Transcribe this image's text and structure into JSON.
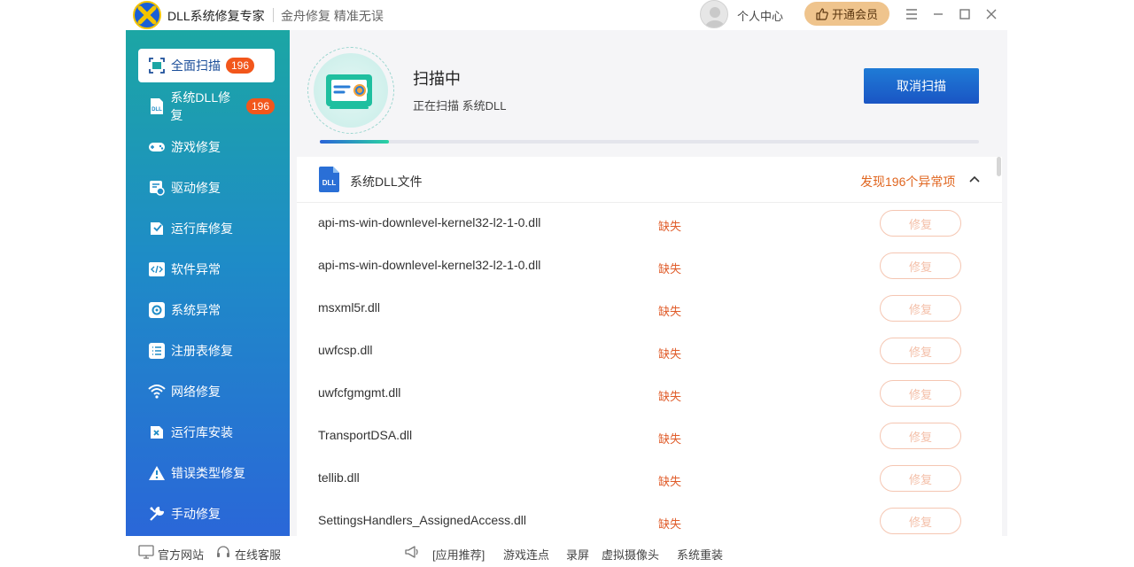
{
  "app": {
    "name": "DLL系统修复专家",
    "slogan": "金舟修复 精准无误",
    "user_center": "个人中心",
    "vip_label": "开通会员"
  },
  "sidebar": {
    "items": [
      {
        "label": "全面扫描",
        "badge": "196",
        "icon": "scan-icon",
        "active": true
      },
      {
        "label": "系统DLL修复",
        "badge": "196",
        "icon": "dll-file-icon"
      },
      {
        "label": "游戏修复",
        "icon": "gamepad-icon"
      },
      {
        "label": "驱动修复",
        "icon": "driver-icon"
      },
      {
        "label": "运行库修复",
        "icon": "runtime-icon"
      },
      {
        "label": "软件异常",
        "icon": "code-icon"
      },
      {
        "label": "系统异常",
        "icon": "gear-icon"
      },
      {
        "label": "注册表修复",
        "icon": "list-icon"
      },
      {
        "label": "网络修复",
        "icon": "wifi-icon"
      },
      {
        "label": "运行库安装",
        "icon": "runtime-install-icon"
      },
      {
        "label": "错误类型修复",
        "icon": "warning-icon"
      },
      {
        "label": "手动修复",
        "icon": "wrench-icon"
      }
    ]
  },
  "scan": {
    "title": "扫描中",
    "subtitle": "正在扫描 系统DLL",
    "cancel_label": "取消扫描",
    "progress": 0.105
  },
  "group": {
    "title": "系统DLL文件",
    "count_text": "发现196个异常项"
  },
  "rows": [
    {
      "name": "api-ms-win-downlevel-kernel32-l2-1-0.dll",
      "status": "缺失",
      "action": "修复"
    },
    {
      "name": "api-ms-win-downlevel-kernel32-l2-1-0.dll",
      "status": "缺失",
      "action": "修复"
    },
    {
      "name": "msxml5r.dll",
      "status": "缺失",
      "action": "修复"
    },
    {
      "name": "uwfcsp.dll",
      "status": "缺失",
      "action": "修复"
    },
    {
      "name": "uwfcfgmgmt.dll",
      "status": "缺失",
      "action": "修复"
    },
    {
      "name": "TransportDSA.dll",
      "status": "缺失",
      "action": "修复"
    },
    {
      "name": "tellib.dll",
      "status": "缺失",
      "action": "修复"
    },
    {
      "name": "SettingsHandlers_AssignedAccess.dll",
      "status": "缺失",
      "action": "修复"
    }
  ],
  "footer": {
    "official_site": "官方网站",
    "online_support": "在线客服",
    "recommend": "[应用推荐]",
    "links": [
      "游戏连点",
      "录屏",
      "虚拟摄像头",
      "系统重装"
    ]
  },
  "colors": {
    "sidebar_top": "#1ca6a4",
    "sidebar_bottom": "#2a67d8",
    "badge": "#f2561b",
    "status_missing": "#e05c2a",
    "primary_button": "#1a55c4",
    "vip": "#efc48d"
  }
}
